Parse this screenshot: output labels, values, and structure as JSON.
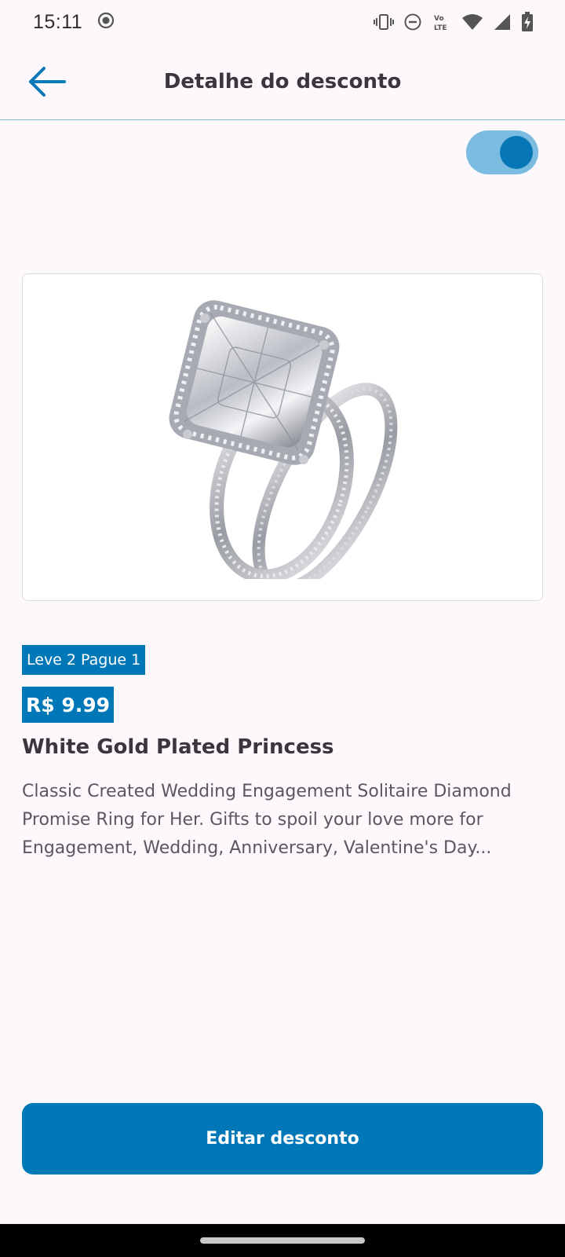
{
  "status_bar": {
    "time": "15:11",
    "icons": [
      "screen-record-icon",
      "vibrate-icon",
      "do-not-disturb-icon",
      "volte-icon",
      "wifi-icon",
      "cell-signal-icon",
      "battery-charging-icon"
    ]
  },
  "header": {
    "title": "Detalhe do desconto",
    "back_icon": "arrow-left-icon"
  },
  "discount": {
    "active": true,
    "offer_label": "Leve 2 Pague 1",
    "price": "R$ 9.99"
  },
  "product": {
    "name": "White Gold Plated Princess",
    "description": "Classic Created Wedding Engagement Solitaire Diamond Promise Ring for Her. Gifts to spoil your love more for Engagement, Wedding, Anniversary, Valentine's Day..."
  },
  "actions": {
    "edit_label": "Editar desconto"
  },
  "colors": {
    "primary": "#0078B7",
    "toggle_track": "#7BBCE0",
    "background": "#FDF8FC"
  }
}
